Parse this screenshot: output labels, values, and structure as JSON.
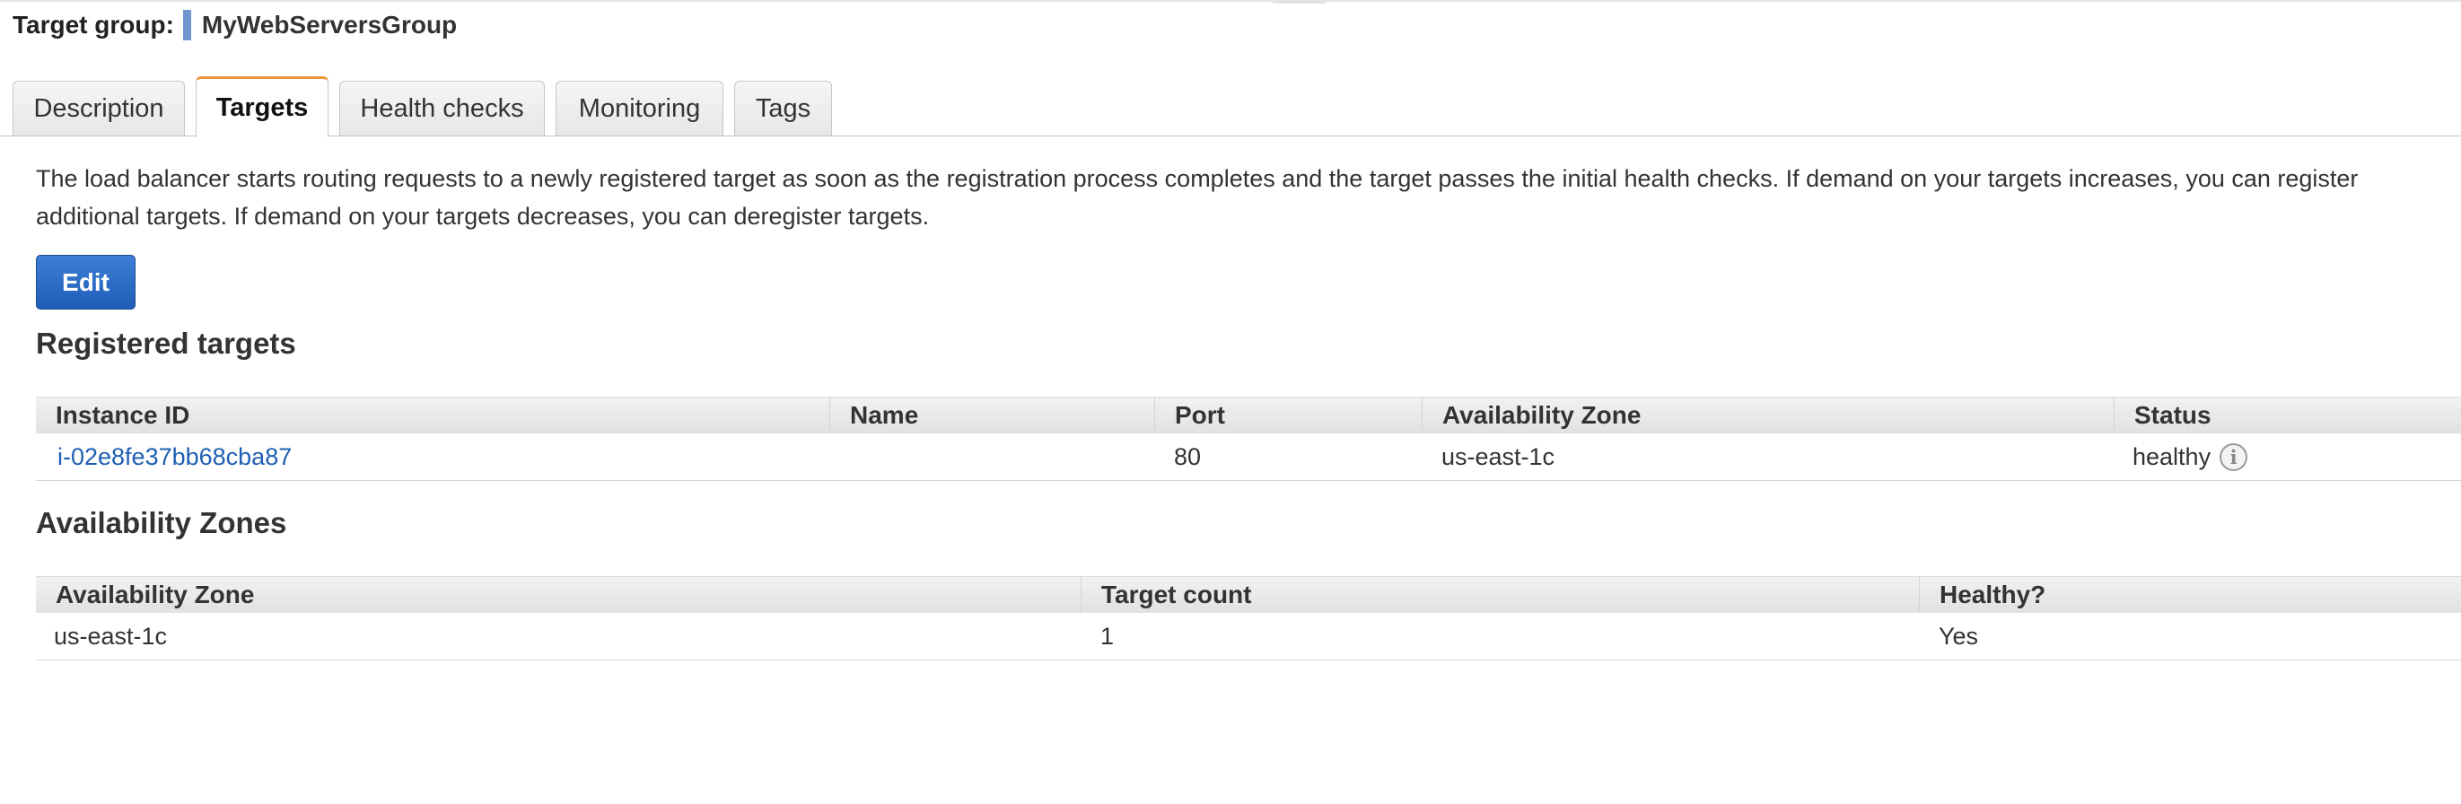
{
  "target_group": {
    "label": "Target group:",
    "name": "MyWebServersGroup"
  },
  "tabs": [
    {
      "label": "Description",
      "active": false
    },
    {
      "label": "Targets",
      "active": true
    },
    {
      "label": "Health checks",
      "active": false
    },
    {
      "label": "Monitoring",
      "active": false
    },
    {
      "label": "Tags",
      "active": false
    }
  ],
  "description": {
    "line1": "The load balancer starts routing requests to a newly registered target as soon as the registration process completes and the target passes the initial health checks. If demand on your targets increases, you can register",
    "line2": "additional targets. If demand on your targets decreases, you can deregister targets."
  },
  "edit_button": {
    "label": "Edit"
  },
  "registered_targets": {
    "title": "Registered targets",
    "columns": [
      "Instance ID",
      "Name",
      "Port",
      "Availability Zone",
      "Status"
    ],
    "rows": [
      {
        "instance_id": "i-02e8fe37bb68cba87",
        "name": "",
        "port": "80",
        "availability_zone": "us-east-1c",
        "status": "healthy"
      }
    ]
  },
  "availability_zones": {
    "title": "Availability Zones",
    "columns": [
      "Availability Zone",
      "Target count",
      "Healthy?"
    ],
    "rows": [
      {
        "availability_zone": "us-east-1c",
        "target_count": "1",
        "healthy": "Yes"
      }
    ]
  },
  "colors": {
    "tab_active_accent": "#f0953a",
    "primary_button": "#1f5db8",
    "link": "#1f5fb3",
    "target_group_marker": "#6e97d0"
  },
  "icons": {
    "status_info": "info-icon"
  }
}
